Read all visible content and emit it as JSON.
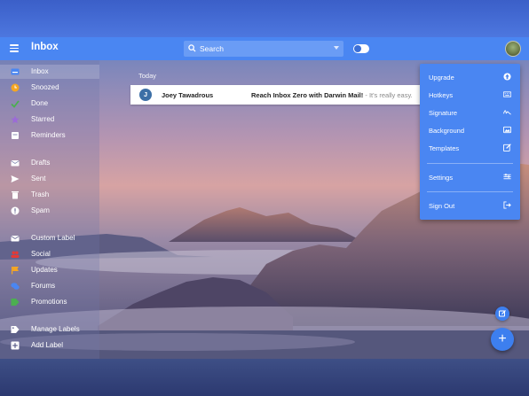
{
  "header": {
    "title": "Inbox",
    "search_placeholder": "Search"
  },
  "sidebar": {
    "items": [
      {
        "label": "Inbox",
        "icon": "inbox-icon",
        "color": "#4a86f2"
      },
      {
        "label": "Snoozed",
        "icon": "clock-icon",
        "color": "#f5a623"
      },
      {
        "label": "Done",
        "icon": "check-icon",
        "color": "#4caf50"
      },
      {
        "label": "Starred",
        "icon": "star-icon",
        "color": "#9c6ad8"
      },
      {
        "label": "Reminders",
        "icon": "reminder-icon",
        "color": "#ffffff"
      },
      {
        "label": "Drafts",
        "icon": "draft-icon",
        "color": "#ffffff"
      },
      {
        "label": "Sent",
        "icon": "send-icon",
        "color": "#ffffff"
      },
      {
        "label": "Trash",
        "icon": "trash-icon",
        "color": "#ffffff"
      },
      {
        "label": "Spam",
        "icon": "spam-icon",
        "color": "#ffffff"
      },
      {
        "label": "Custom Label",
        "icon": "mail-icon",
        "color": "#ffffff"
      },
      {
        "label": "Social",
        "icon": "people-icon",
        "color": "#e53935"
      },
      {
        "label": "Updates",
        "icon": "flag-icon",
        "color": "#f5a623"
      },
      {
        "label": "Forums",
        "icon": "forum-icon",
        "color": "#4a86f2"
      },
      {
        "label": "Promotions",
        "icon": "tag-icon",
        "color": "#4caf50"
      },
      {
        "label": "Manage Labels",
        "icon": "label-icon",
        "color": "#ffffff"
      },
      {
        "label": "Add Label",
        "icon": "add-box-icon",
        "color": "#ffffff"
      }
    ]
  },
  "main": {
    "section_label": "Today",
    "messages": [
      {
        "avatar_letter": "J",
        "sender": "Joey Tawadrous",
        "subject": "Reach Inbox Zero with Darwin Mail!",
        "snippet": " - It's really easy."
      }
    ]
  },
  "menu": {
    "items": [
      {
        "label": "Upgrade",
        "icon": "upgrade-icon"
      },
      {
        "label": "Hotkeys",
        "icon": "keyboard-icon"
      },
      {
        "label": "Signature",
        "icon": "signature-icon"
      },
      {
        "label": "Background",
        "icon": "image-icon"
      },
      {
        "label": "Templates",
        "icon": "edit-icon"
      },
      {
        "label": "Settings",
        "icon": "settings-sliders-icon"
      },
      {
        "label": "Sign Out",
        "icon": "sign-out-icon"
      }
    ]
  },
  "fab": {
    "compose_icon": "compose-icon",
    "add_symbol": "+"
  },
  "colors": {
    "accent": "#4a86f2",
    "menu_bg": "#4a86f2"
  }
}
